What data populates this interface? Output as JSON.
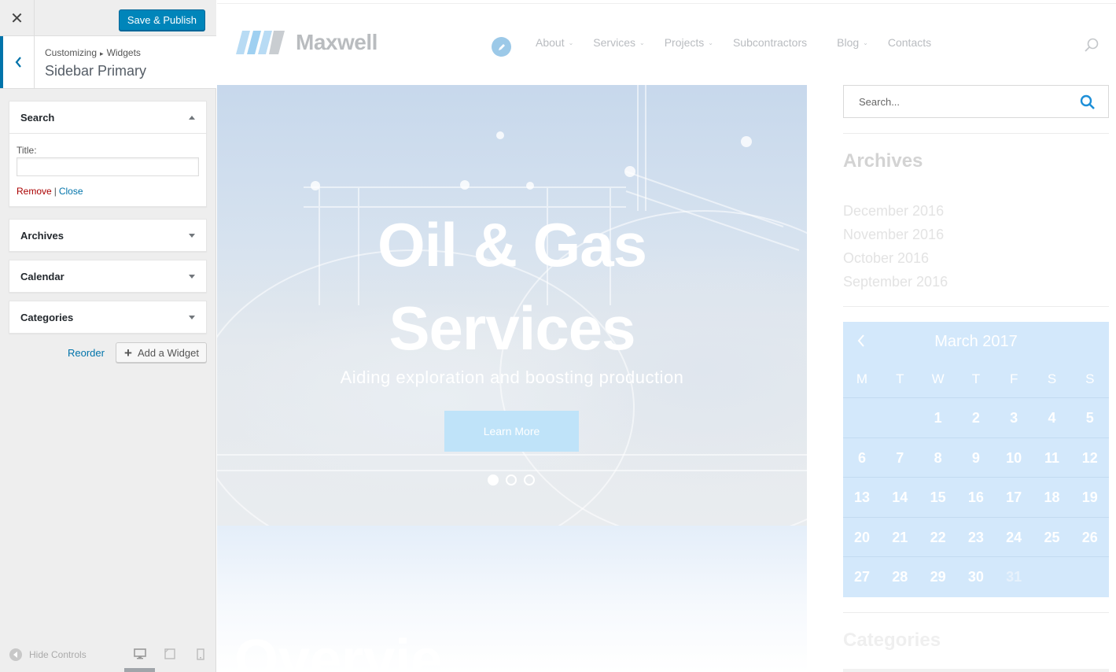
{
  "customizer": {
    "close_icon": "close-icon",
    "save_label": "Save & Publish",
    "breadcrumb": {
      "part1": "Customizing",
      "separator": "▸",
      "part2": "Widgets"
    },
    "section_title": "Sidebar Primary",
    "widgets": {
      "search": {
        "name": "Search",
        "title_label": "Title:",
        "title_value": "",
        "remove_label": "Remove",
        "pipe": "|",
        "close_label": "Close"
      },
      "archives": {
        "name": "Archives"
      },
      "calendar": {
        "name": "Calendar"
      },
      "categories": {
        "name": "Categories"
      }
    },
    "reorder_label": "Reorder",
    "add_widget_label": "Add a Widget",
    "hide_controls_label": "Hide Controls",
    "devices": [
      "desktop-icon",
      "tablet-icon",
      "mobile-icon"
    ],
    "accent_color": "#0085ba"
  },
  "site": {
    "logo_text": "Maxwell",
    "nav": [
      {
        "label": "About",
        "has_dropdown": true
      },
      {
        "label": "Services",
        "has_dropdown": true
      },
      {
        "label": "Projects",
        "has_dropdown": true
      },
      {
        "label": "Subcontractors",
        "has_dropdown": false
      },
      {
        "label": "Blog",
        "has_dropdown": true
      },
      {
        "label": "Contacts",
        "has_dropdown": false
      }
    ],
    "hero": {
      "title_line1": "Oil & Gas",
      "title_line2": "Services",
      "subtitle": "Aiding exploration and boosting production",
      "button": "Learn More",
      "slides": 3,
      "active_slide": 1
    },
    "section_heading": "Overvie",
    "sidebar": {
      "search_placeholder": "Search...",
      "archives_title": "Archives",
      "archives": [
        "December 2016",
        "November 2016",
        "October 2016",
        "September 2016"
      ],
      "calendar": {
        "month": "March 2017",
        "days_of_week": [
          "M",
          "T",
          "W",
          "T",
          "F",
          "S",
          "S"
        ],
        "weeks": [
          [
            "",
            "",
            "1",
            "2",
            "3",
            "4",
            "5"
          ],
          [
            "6",
            "7",
            "8",
            "9",
            "10",
            "11",
            "12"
          ],
          [
            "13",
            "14",
            "15",
            "16",
            "17",
            "18",
            "19"
          ],
          [
            "20",
            "21",
            "22",
            "23",
            "24",
            "25",
            "26"
          ],
          [
            "27",
            "28",
            "29",
            "30",
            "31",
            "",
            ""
          ]
        ]
      },
      "categories_title": "Categories"
    },
    "calendar_color": "#d3e8fb"
  }
}
